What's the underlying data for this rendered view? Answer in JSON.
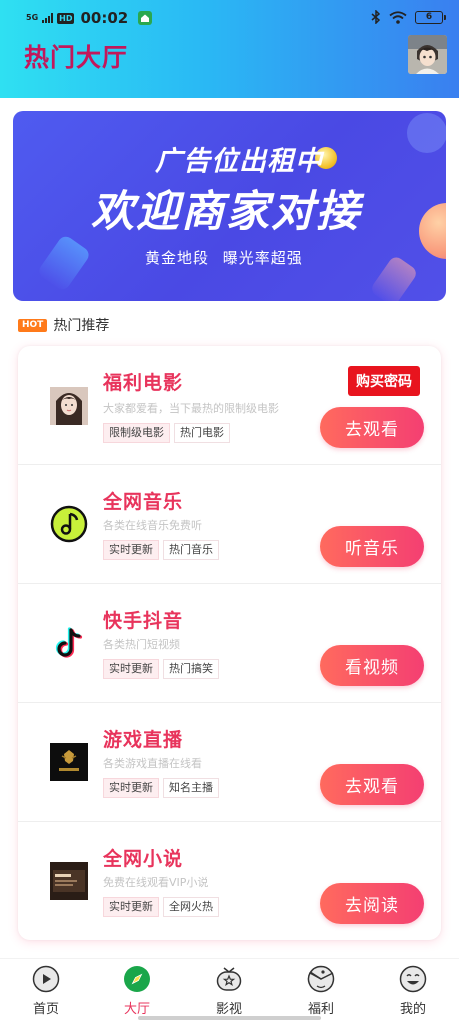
{
  "status_bar": {
    "network": "5G",
    "hd": "HD",
    "time": "00:02",
    "battery": "6"
  },
  "header": {
    "title": "热门大厅"
  },
  "banner": {
    "title_line1": "广告位出租中",
    "title_line2": "欢迎商家对接",
    "subtitle": "黄金地段  曝光率超强"
  },
  "section": {
    "badge": "HOT",
    "title": "热门推荐"
  },
  "items": [
    {
      "title": "福利电影",
      "desc": "大家都爱看，当下最热的限制级电影",
      "tags": [
        "限制级电影",
        "热门电影"
      ],
      "button": "去观看",
      "badge": "购买密码",
      "icon": "movie-thumbnail"
    },
    {
      "title": "全网音乐",
      "desc": "各类在线音乐免费听",
      "tags": [
        "实时更新",
        "热门音乐"
      ],
      "button": "听音乐",
      "icon": "music-note-icon"
    },
    {
      "title": "快手抖音",
      "desc": "各类热门短视频",
      "tags": [
        "实时更新",
        "热门搞笑"
      ],
      "button": "看视频",
      "icon": "tiktok-icon"
    },
    {
      "title": "游戏直播",
      "desc": "各类游戏直播在线看",
      "tags": [
        "实时更新",
        "知名主播"
      ],
      "button": "去观看",
      "icon": "game-live-thumbnail"
    },
    {
      "title": "全网小说",
      "desc": "免费在线观看VIP小说",
      "tags": [
        "实时更新",
        "全网火热"
      ],
      "button": "去阅读",
      "icon": "novel-thumbnail"
    }
  ],
  "tabs": [
    {
      "label": "首页",
      "icon": "play-circle-icon",
      "active": false
    },
    {
      "label": "大厅",
      "icon": "compass-icon",
      "active": true
    },
    {
      "label": "影视",
      "icon": "tv-icon",
      "active": false
    },
    {
      "label": "福利",
      "icon": "pacman-icon",
      "active": false
    },
    {
      "label": "我的",
      "icon": "smiley-icon",
      "active": false
    }
  ],
  "colors": {
    "accent": "#e8345c",
    "header_gradient_start": "#2fe0f2",
    "header_gradient_end": "#3a7ff0",
    "banner_bg": "#4a49e4",
    "button_gradient_start": "#ff6a5e",
    "button_gradient_end": "#f43f72",
    "active_tab": "#1aa64a"
  }
}
